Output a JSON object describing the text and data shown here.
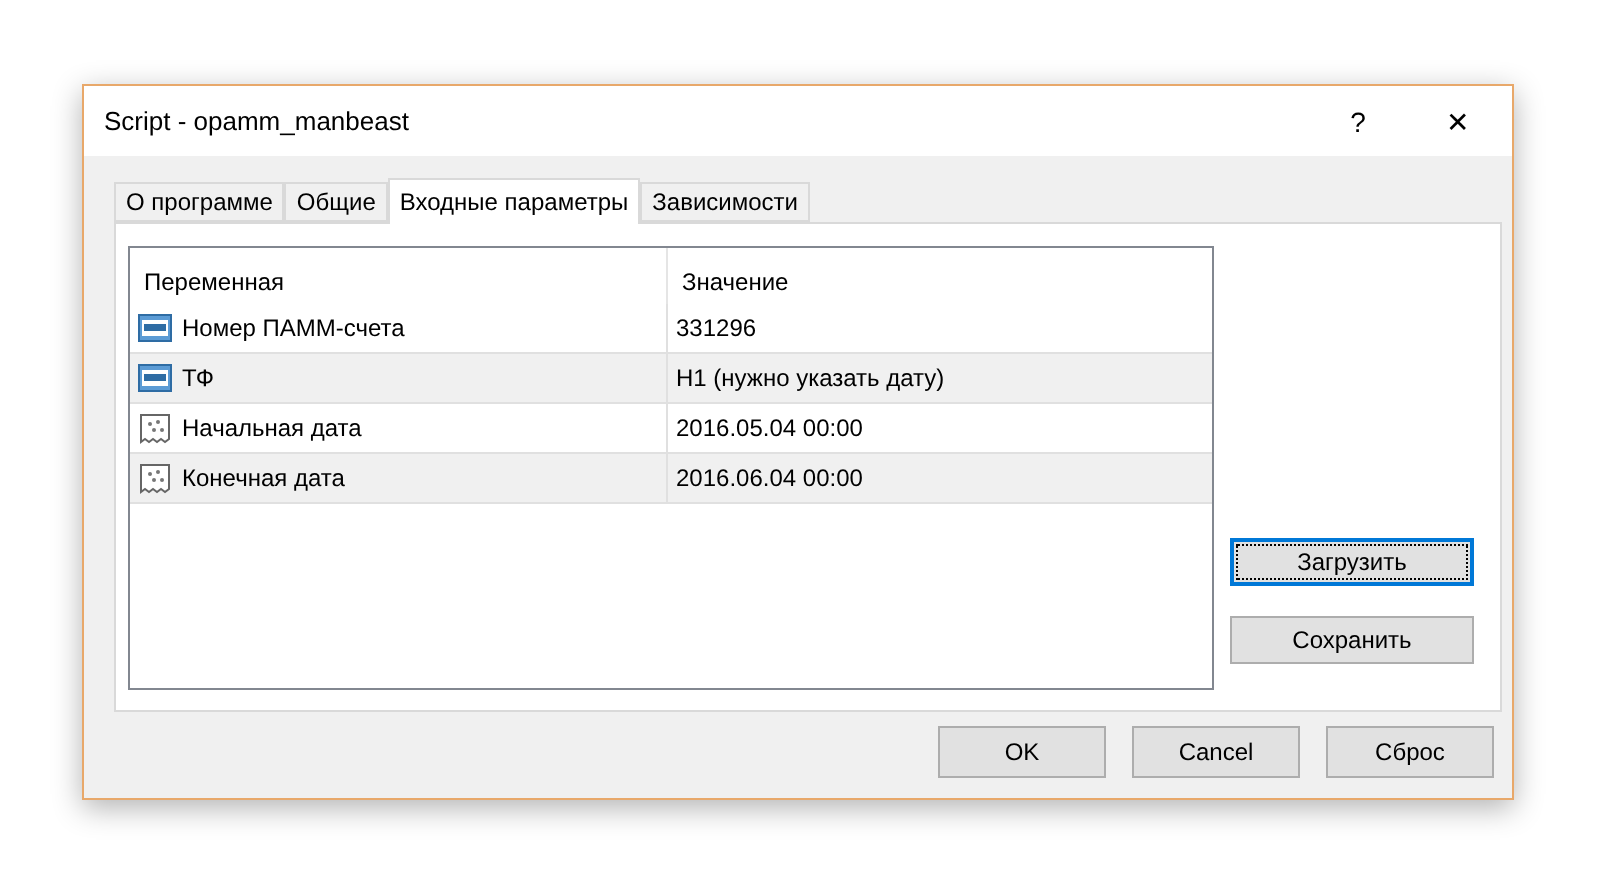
{
  "window": {
    "title": "Script - opamm_manbeast",
    "help": "?",
    "close": "✕"
  },
  "tabs": [
    {
      "label": "О программе",
      "selected": false
    },
    {
      "label": "Общие",
      "selected": false
    },
    {
      "label": "Входные параметры",
      "selected": true
    },
    {
      "label": "Зависимости",
      "selected": false
    }
  ],
  "table": {
    "columns": [
      "Переменная",
      "Значение"
    ],
    "rows": [
      {
        "kind": "number",
        "name": "Номер ПАММ-счета",
        "value": "331296"
      },
      {
        "kind": "number",
        "name": "ТФ",
        "value": "H1 (нужно указать дату)"
      },
      {
        "kind": "date",
        "name": "Начальная дата",
        "value": "2016.05.04 00:00"
      },
      {
        "kind": "date",
        "name": "Конечная дата",
        "value": "2016.06.04 00:00"
      }
    ]
  },
  "side_buttons": [
    {
      "label": "Загрузить",
      "focused": true
    },
    {
      "label": "Сохранить",
      "focused": false
    }
  ],
  "buttons": [
    "OK",
    "Cancel",
    "Сброс"
  ]
}
